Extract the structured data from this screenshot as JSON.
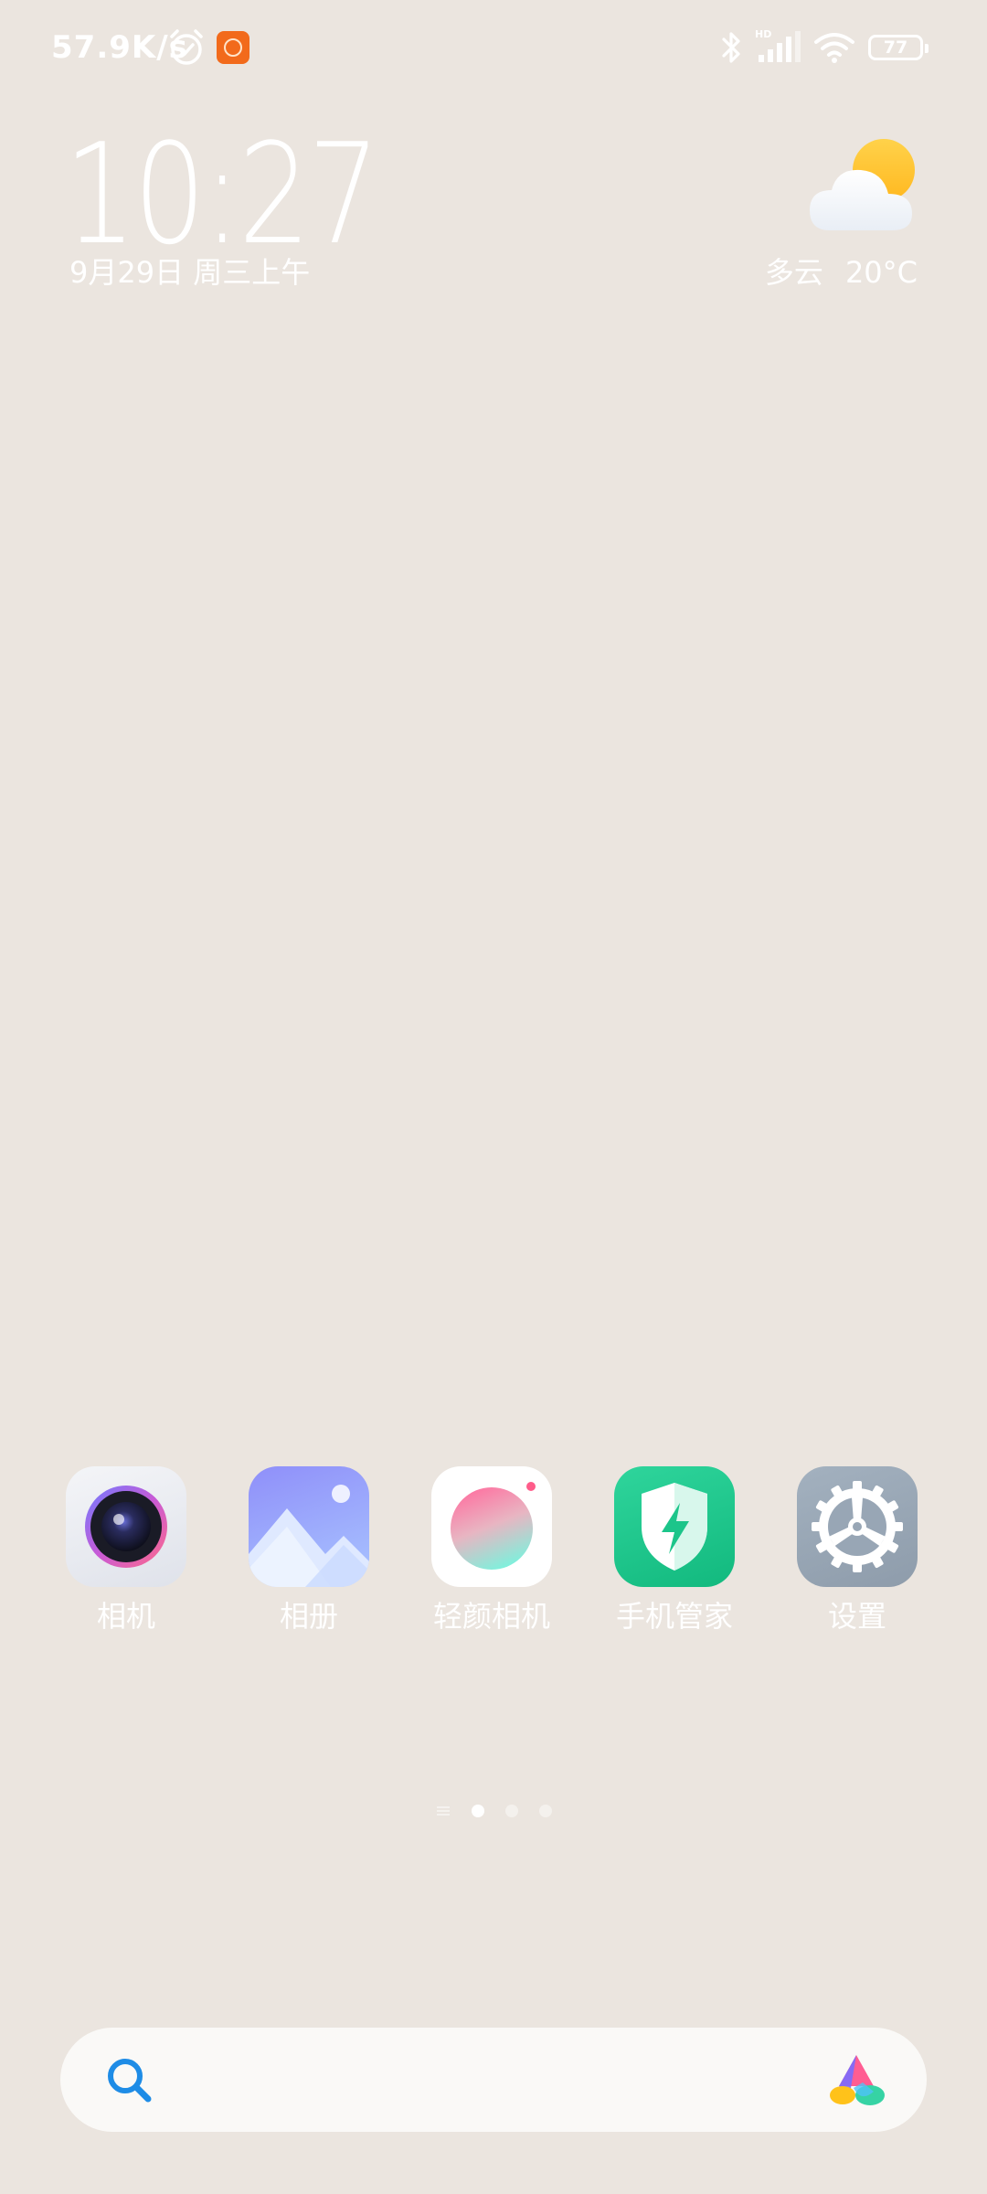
{
  "status_bar": {
    "net_speed": "57.9K/s",
    "battery_level": "77",
    "icons": [
      "alarm-icon",
      "notification-app-icon",
      "bluetooth-icon",
      "hd-signal-icon",
      "wifi-icon",
      "battery-icon"
    ]
  },
  "clock": {
    "time": "10:27",
    "date": "9月29日 周三上午"
  },
  "weather": {
    "condition": "多云",
    "temperature": "20°C",
    "icon": "partly-cloudy-icon"
  },
  "dock": {
    "apps": [
      {
        "label": "相机",
        "icon": "camera-icon"
      },
      {
        "label": "相册",
        "icon": "gallery-icon"
      },
      {
        "label": "轻颜相机",
        "icon": "beauty-camera-icon"
      },
      {
        "label": "手机管家",
        "icon": "security-shield-icon"
      },
      {
        "label": "设置",
        "icon": "settings-gear-icon"
      }
    ]
  },
  "pager": {
    "pages": 3,
    "active_page": 1
  },
  "search": {
    "placeholder": ""
  },
  "colors": {
    "wallpaper": "#ebe5df",
    "text": "#ffffff",
    "search_icon": "#1e8ce6",
    "security_green": "#1cc58a",
    "settings_grey": "#98a6b5"
  }
}
